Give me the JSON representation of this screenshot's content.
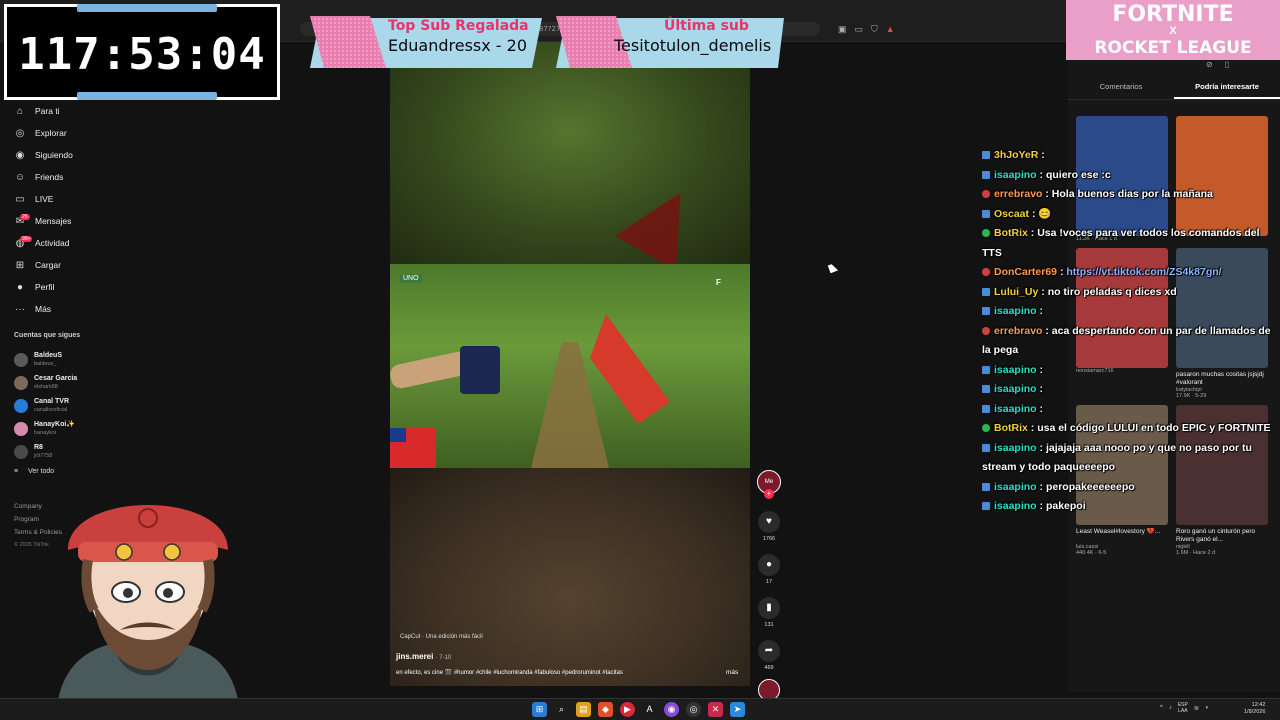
{
  "timer": {
    "value": "117:53:04"
  },
  "banners": {
    "top_sub": {
      "label": "Top Sub Regalada",
      "value": "Eduandressx - 20"
    },
    "last_sub": {
      "label": "Última sub",
      "value": "Tesitotulon_demelis"
    }
  },
  "fortnite": {
    "line1": "FORTNITE",
    "line2": "X",
    "line3": "ROCKET LEAGUE"
  },
  "sidebar": {
    "items": [
      {
        "label": "Para ti",
        "icon": "home-icon"
      },
      {
        "label": "Explorar",
        "icon": "compass-icon"
      },
      {
        "label": "Siguiendo",
        "icon": "following-icon"
      },
      {
        "label": "Friends",
        "icon": "friends-icon"
      },
      {
        "label": "LIVE",
        "icon": "live-icon"
      },
      {
        "label": "Mensajes",
        "icon": "messages-icon",
        "badge": "26"
      },
      {
        "label": "Actividad",
        "icon": "activity-icon",
        "badge": "99+"
      },
      {
        "label": "Cargar",
        "icon": "upload-icon"
      },
      {
        "label": "Perfil",
        "icon": "profile-icon"
      },
      {
        "label": "Más",
        "icon": "more-icon"
      }
    ],
    "following_title": "Cuentas que sigues",
    "following": [
      {
        "name": "BaldeuS",
        "user": "baldeus_"
      },
      {
        "name": "Cesar Garcia",
        "user": "elshark88"
      },
      {
        "name": "Canal TVR",
        "user": "canaltvroficial"
      },
      {
        "name": "HanayKoi✨",
        "user": "hanaykoi"
      },
      {
        "name": "R8",
        "user": "jr97758"
      }
    ],
    "see_all": "Ver todo",
    "footer": {
      "company": "Company",
      "program": "Program",
      "terms": "Terms & Policies",
      "copyright": "© 2026 TikTok"
    }
  },
  "video": {
    "capcut": "CapCut · Una edición más fácil",
    "author": "jins.merei",
    "date": "· 7-10",
    "description": "en efecto, es cine 🎬 #humor #chile #luchomiranda #fabuloso #pedroruminot #tacitas",
    "more": "más",
    "likes": "1766",
    "comments": "17",
    "saves": "131",
    "shares": "469"
  },
  "right_panel": {
    "tab_comments": "Comentarios",
    "tab_interest": "Podría interesarte",
    "thumbs": [
      {
        "title": "",
        "author": "",
        "stats": "11.2K · Hace 1 d",
        "color": "#2a4a8a"
      },
      {
        "title": "",
        "author": "",
        "stats": "",
        "color": "#c45a2a"
      },
      {
        "title": "",
        "author": "nonsiamarc716",
        "stats": "",
        "color": "#a63a3a"
      },
      {
        "title": "pasaron muchas cositas jsjsjdj #valorant",
        "author": "katylachipi",
        "stats": "17.9K · 5-29",
        "color": "#3a4a5a"
      },
      {
        "title": "Least Weasel#lovestory 💔...",
        "author": "luis.cassi",
        "stats": "440.4K · 6-5",
        "color": "#6a5a4a"
      },
      {
        "title": "Roro ganó un cinturón pero Rivers ganó el...",
        "author": "nigkill",
        "stats": "1.6M · Hace 2 d",
        "color": "#4a3030"
      }
    ]
  },
  "chat": [
    {
      "user": "3hJoYeR",
      "text": "",
      "cls": "y",
      "icon": "ic"
    },
    {
      "user": "isaapino",
      "text": "quiero ese :c",
      "cls": "",
      "icon": "ic"
    },
    {
      "user": "errebravo",
      "text": "Hola buenos dias por la mañana",
      "cls": "o",
      "icon": "ic rd"
    },
    {
      "user": "Oscaat",
      "text": "😊",
      "cls": "y",
      "icon": "ic"
    },
    {
      "user": "BotRix",
      "text": "Usa !voces para ver todos los comandos del TTS",
      "cls": "y",
      "icon": "ic gr"
    },
    {
      "user": "DonCarter69",
      "text": "https://vt.tiktok.com/ZS4k87gn/",
      "cls": "o",
      "icon": "ic rd",
      "link": true
    },
    {
      "user": "Lului_Uy",
      "text": "no tiro peladas q dices xd",
      "cls": "y",
      "icon": "ic"
    },
    {
      "user": "isaapino",
      "text": "",
      "cls": "",
      "icon": "ic"
    },
    {
      "user": "errebravo",
      "text": "aca despertando con un par de llamados de la pega",
      "cls": "o",
      "icon": "ic rd"
    },
    {
      "user": "isaapino",
      "text": "",
      "cls": "",
      "icon": "ic"
    },
    {
      "user": "isaapino",
      "text": "",
      "cls": "",
      "icon": "ic"
    },
    {
      "user": "isaapino",
      "text": "",
      "cls": "",
      "icon": "ic"
    },
    {
      "user": "BotRix",
      "text": "usa el código LULUI en todo EPIC y FORTNITE",
      "cls": "y",
      "icon": "ic gr"
    },
    {
      "user": "isaapino",
      "text": "jajajaja aaa nooo po y que no paso por tu stream y todo paqueeeepo",
      "cls": "",
      "icon": "ic"
    },
    {
      "user": "isaapino",
      "text": "peropakeeeeeepo",
      "cls": "",
      "icon": "ic"
    },
    {
      "user": "isaapino",
      "text": "pakepoi",
      "cls": "",
      "icon": "ic"
    }
  ],
  "taskbar": {
    "lang1": "ESP",
    "lang2": "LAA",
    "time": "12:42",
    "date": "1/8/2026"
  },
  "colors": {
    "accent": "#fe2c55",
    "chat_user": "#27e0c8",
    "timer_bar": "#7ab3e0",
    "banner_bg": "#a9d8ea",
    "banner_label": "#e8336f"
  }
}
